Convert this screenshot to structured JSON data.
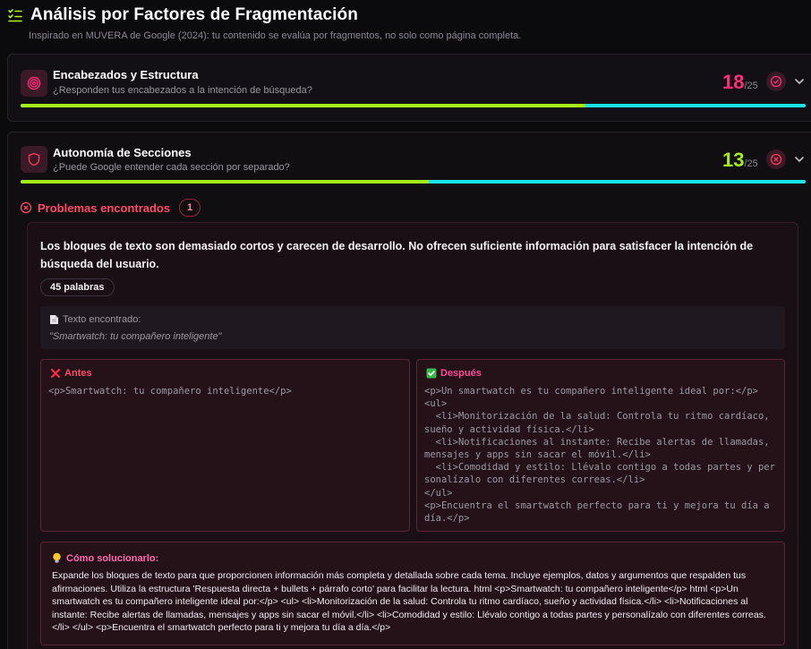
{
  "header": {
    "title": "Análisis por Factores de Fragmentación",
    "subtitle": "Inspirado en MUVERA de Google (2024): tu contenido se evalúa por fragmentos, no solo como página completa."
  },
  "factors": [
    {
      "title": "Encabezados y Estructura",
      "subtitle": "¿Responden tus encabezados a la intención de búsqueda?",
      "score": "18",
      "max": "/25",
      "score_color": "#ff2d7a",
      "status": "check",
      "progress": 0.72,
      "icon": "target-icon"
    },
    {
      "title": "Autonomía de Secciones",
      "subtitle": "¿Puede Google entender cada sección por separado?",
      "score": "13",
      "max": "/25",
      "score_color": "#a6ec1a",
      "status": "x",
      "progress": 0.52,
      "icon": "shield-icon"
    }
  ],
  "problems": {
    "label": "Problemas encontrados",
    "count": "1"
  },
  "issue": {
    "description": "Los bloques de texto son demasiado cortos y carecen de desarrollo. No ofrecen suficiente información para satisfacer la intención de búsqueda del usuario.",
    "words": "45 palabras",
    "found_label": "Texto encontrado:",
    "found_quote": "\"Smartwatch: tu compañero inteligente\"",
    "before_label": "Antes",
    "before_code": "<p>Smartwatch: tu compañero inteligente</p>",
    "after_label": "Después",
    "after_code": "<p>Un smartwatch es tu compañero inteligente ideal por:</p>\n<ul>\n  <li>Monitorización de la salud: Controla tu ritmo cardíaco, sueño y actividad física.</li>\n  <li>Notificaciones al instante: Recibe alertas de llamadas, mensajes y apps sin sacar el móvil.</li>\n  <li>Comodidad y estilo: Llévalo contigo a todas partes y personalízalo con diferentes correas.</li>\n</ul>\n<p>Encuentra el smartwatch perfecto para ti y mejora tu día a día.</p>",
    "solution_label": "Cómo solucionarlo:",
    "solution_text": "Expande los bloques de texto para que proporcionen información más completa y detallada sobre cada tema. Incluye ejemplos, datos y argumentos que respalden tus afirmaciones. Utiliza la estructura 'Respuesta directa + bullets + párrafo corto' para facilitar la lectura. html <p>Smartwatch: tu compañero inteligente</p> html <p>Un smartwatch es tu compañero inteligente ideal por:</p> <ul> <li>Monitorización de la salud: Controla tu ritmo cardíaco, sueño y actividad física.</li> <li>Notificaciones al instante: Recibe alertas de llamadas, mensajes y apps sin sacar el móvil.</li> <li>Comodidad y estilo: Llévalo contigo a todas partes y personalízalo con diferentes correas.</li> </ul> <p>Encuentra el smartwatch perfecto para ti y mejora tu día a día.</p>"
  }
}
